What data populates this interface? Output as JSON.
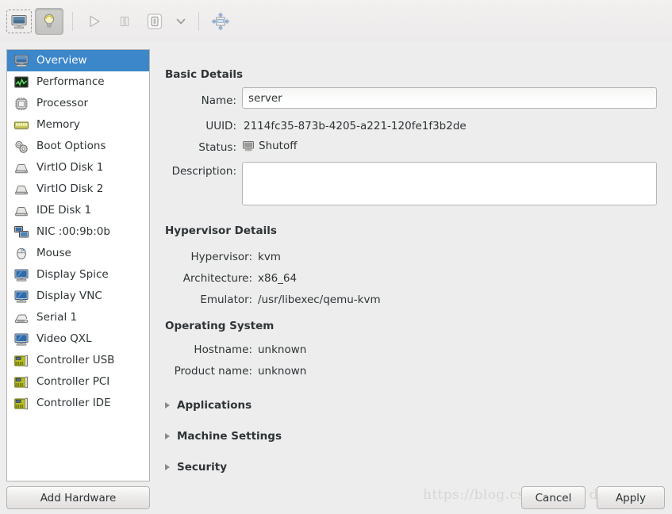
{
  "toolbar": {
    "buttons": [
      {
        "name": "console-view-button",
        "icon": "monitor-icon",
        "state": "focused"
      },
      {
        "name": "details-view-button",
        "icon": "lightbulb-icon",
        "state": "pressed"
      },
      {
        "name": "run-button",
        "icon": "play-icon",
        "state": "disabled"
      },
      {
        "name": "pause-button",
        "icon": "pause-icon",
        "state": "disabled"
      },
      {
        "name": "shutdown-button",
        "icon": "power-icon",
        "state": "normal"
      },
      {
        "name": "shutdown-menu-button",
        "icon": "chevron-down-icon",
        "state": "normal"
      },
      {
        "name": "fullscreen-button",
        "icon": "fullscreen-icon",
        "state": "normal"
      }
    ]
  },
  "sidebar": {
    "items": [
      {
        "label": "Overview",
        "icon": "monitor-icon",
        "selected": true
      },
      {
        "label": "Performance",
        "icon": "graph-icon",
        "selected": false
      },
      {
        "label": "Processor",
        "icon": "cpu-icon",
        "selected": false
      },
      {
        "label": "Memory",
        "icon": "ram-icon",
        "selected": false
      },
      {
        "label": "Boot Options",
        "icon": "gears-icon",
        "selected": false
      },
      {
        "label": "VirtIO Disk 1",
        "icon": "disk-icon",
        "selected": false
      },
      {
        "label": "VirtIO Disk 2",
        "icon": "disk-icon",
        "selected": false
      },
      {
        "label": "IDE Disk 1",
        "icon": "disk-icon",
        "selected": false
      },
      {
        "label": "NIC :00:9b:0b",
        "icon": "network-icon",
        "selected": false
      },
      {
        "label": "Mouse",
        "icon": "mouse-icon",
        "selected": false
      },
      {
        "label": "Display Spice",
        "icon": "display-icon",
        "selected": false
      },
      {
        "label": "Display VNC",
        "icon": "display-icon",
        "selected": false
      },
      {
        "label": "Serial 1",
        "icon": "serial-icon",
        "selected": false
      },
      {
        "label": "Video QXL",
        "icon": "display-icon",
        "selected": false
      },
      {
        "label": "Controller USB",
        "icon": "controller-icon",
        "selected": false
      },
      {
        "label": "Controller PCI",
        "icon": "controller-icon",
        "selected": false
      },
      {
        "label": "Controller IDE",
        "icon": "controller-icon",
        "selected": false
      }
    ],
    "add_hardware_label": "Add Hardware"
  },
  "basic_details": {
    "heading": "Basic Details",
    "name_label": "Name:",
    "name_value": "server",
    "uuid_label": "UUID:",
    "uuid_value": "2114fc35-873b-4205-a221-120fe1f3b2de",
    "status_label": "Status:",
    "status_value": "Shutoff",
    "status_icon": "shutoff-monitor-icon",
    "description_label": "Description:",
    "description_value": ""
  },
  "hypervisor_details": {
    "heading": "Hypervisor Details",
    "rows": [
      {
        "label": "Hypervisor:",
        "value": "kvm"
      },
      {
        "label": "Architecture:",
        "value": "x86_64"
      },
      {
        "label": "Emulator:",
        "value": "/usr/libexec/qemu-kvm"
      }
    ]
  },
  "operating_system": {
    "heading": "Operating System",
    "rows": [
      {
        "label": "Hostname:",
        "value": "unknown"
      },
      {
        "label": "Product name:",
        "value": "unknown"
      }
    ]
  },
  "expanders": [
    {
      "label": "Applications",
      "expanded": false
    },
    {
      "label": "Machine Settings",
      "expanded": false
    },
    {
      "label": "Security",
      "expanded": false
    }
  ],
  "footer": {
    "cancel_label": "Cancel",
    "apply_label": "Apply"
  },
  "watermark": {
    "text": "https://blog.csdn.net/li    de"
  },
  "colors": {
    "selection": "#3c87ca",
    "window_bg": "#ededed",
    "list_bg": "#ffffff",
    "text": "#2e3436",
    "border": "#b6b4b2"
  }
}
